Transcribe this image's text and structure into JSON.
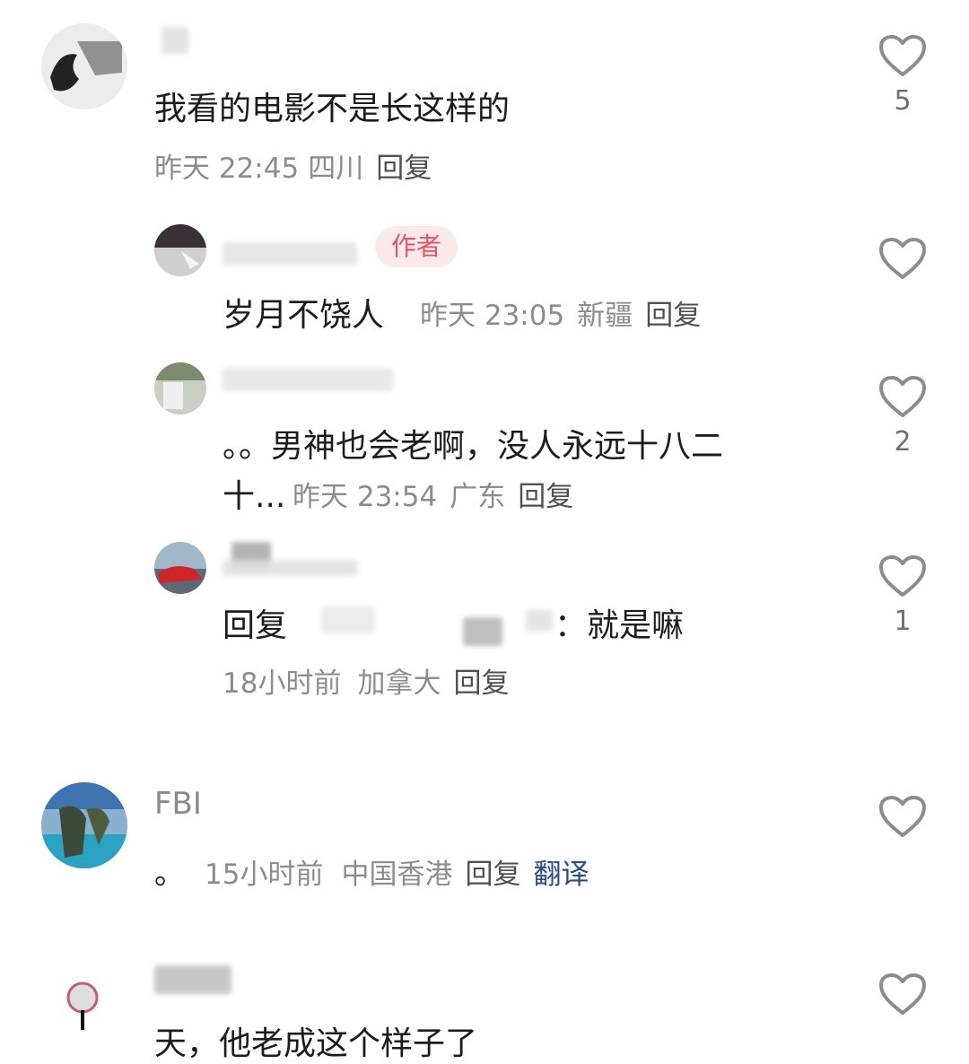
{
  "comments": [
    {
      "text": "我看的电影不是长这样的",
      "time": "昨天 22:45",
      "location": "四川",
      "reply_label": "回复",
      "likes": "5"
    },
    {
      "badge": "作者",
      "text": "岁月不饶人",
      "time": "昨天 23:05",
      "location": "新疆",
      "reply_label": "回复",
      "likes": ""
    },
    {
      "text_line1": "。。男神也会老啊，没人永远十八二",
      "text_line2": "十...",
      "time": "昨天 23:54",
      "location": "广东",
      "reply_label": "回复",
      "likes": "2"
    },
    {
      "reply_prefix": "回复",
      "text": "：就是嘛",
      "time": "18小时前",
      "location": "加拿大",
      "reply_label": "回复",
      "likes": "1"
    },
    {
      "name": "FBI",
      "text": "。",
      "time": "15小时前",
      "location": "中国香港",
      "reply_label": "回复",
      "translate_label": "翻译",
      "likes": ""
    },
    {
      "text": "天，他老成这个样子了",
      "likes": ""
    }
  ],
  "colors": {
    "heart_stroke": "#8c8c8c",
    "translate": "#2b4a85",
    "author_badge_bg": "#fde8ea",
    "author_badge_text": "#e05563"
  }
}
